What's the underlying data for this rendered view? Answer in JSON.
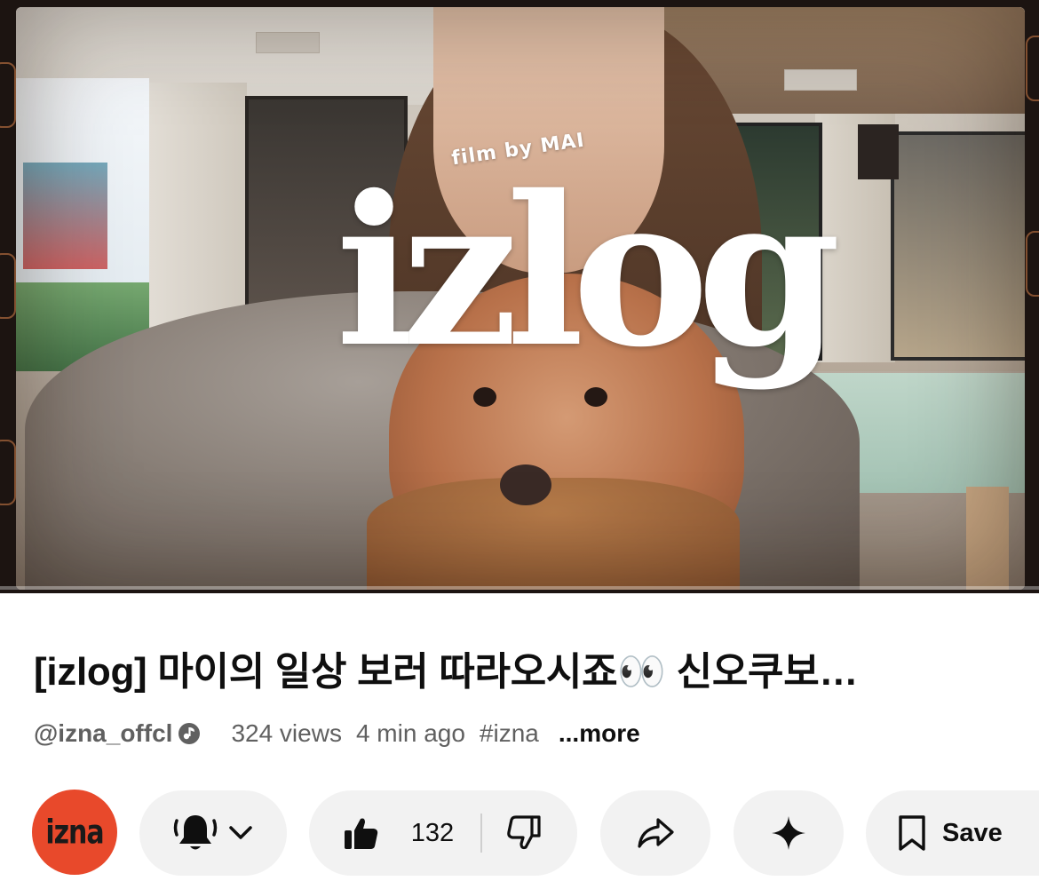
{
  "video": {
    "overlay_film_by": "film by MAI",
    "overlay_logo": "izlog"
  },
  "details": {
    "title": "[izlog] 마이의 일상 보러 따라오시죠👀 신오쿠보…",
    "channel_handle": "@izna_offcl",
    "views": "324 views",
    "time_ago": "4 min ago",
    "hashtag": "#izna",
    "more_label": "...more"
  },
  "actions": {
    "avatar_text": "izna",
    "avatar_color": "#e8492b",
    "like_count": "132",
    "save_label": "Save",
    "icons": [
      "bell-icon",
      "chevron-down-icon",
      "thumbs-up-icon",
      "thumbs-down-icon",
      "share-icon",
      "sparkle-icon",
      "bookmark-icon",
      "verified-icon"
    ]
  }
}
